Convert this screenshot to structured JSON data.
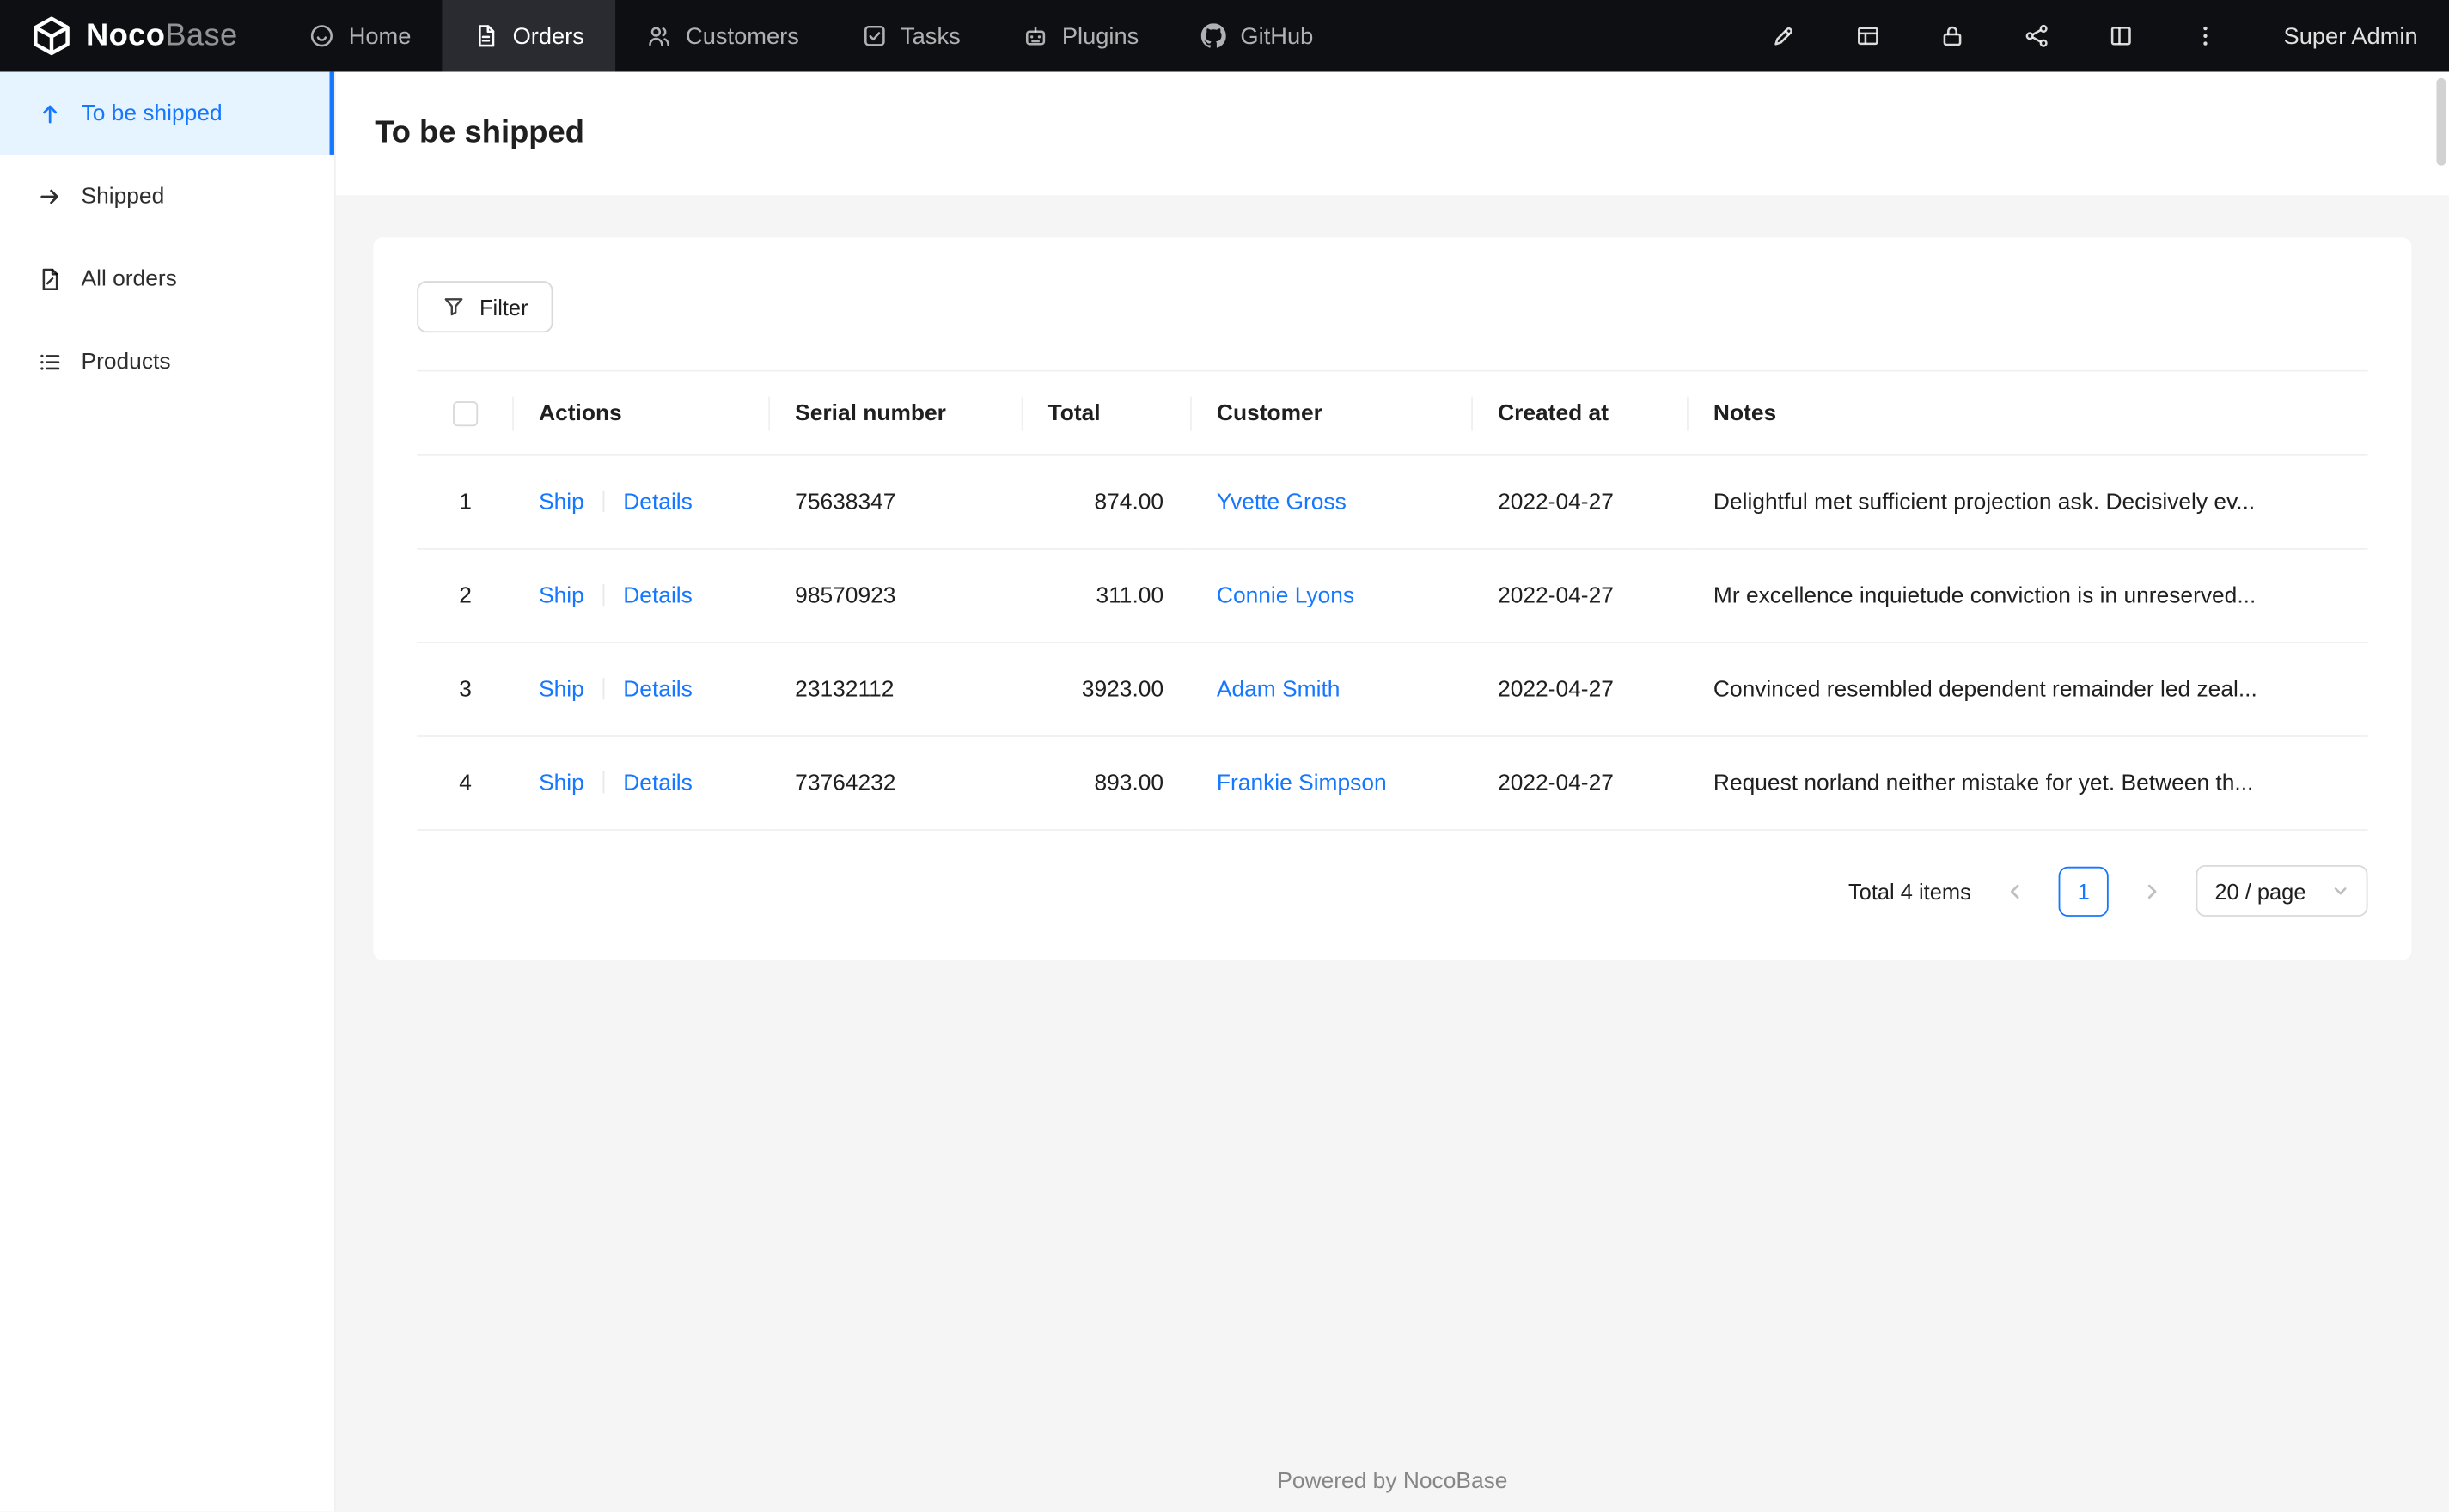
{
  "colors": {
    "accent": "#1677ff",
    "navbar_bg": "#0e0f13",
    "sidebar_active_bg": "#e6f4ff"
  },
  "navbar": {
    "brand": {
      "name_bold": "Noco",
      "name_light": "Base"
    },
    "items": [
      {
        "label": "Home",
        "icon": "home-icon"
      },
      {
        "label": "Orders",
        "icon": "orders-icon"
      },
      {
        "label": "Customers",
        "icon": "customers-icon"
      },
      {
        "label": "Tasks",
        "icon": "tasks-icon"
      },
      {
        "label": "Plugins",
        "icon": "plugins-icon"
      },
      {
        "label": "GitHub",
        "icon": "github-icon"
      }
    ],
    "right_icons": [
      "pen-icon",
      "table-icon",
      "lock-icon",
      "workflow-icon",
      "layout-icon",
      "more-icon"
    ],
    "user": "Super Admin"
  },
  "sidebar": {
    "items": [
      {
        "label": "To be shipped",
        "icon": "arrow-up-icon"
      },
      {
        "label": "Shipped",
        "icon": "arrow-right-icon"
      },
      {
        "label": "All orders",
        "icon": "document-icon"
      },
      {
        "label": "Products",
        "icon": "list-icon"
      }
    ]
  },
  "page": {
    "title": "To be shipped"
  },
  "toolbar": {
    "filter_label": "Filter"
  },
  "table": {
    "columns": [
      "",
      "Actions",
      "Serial number",
      "Total",
      "Customer",
      "Created at",
      "Notes"
    ],
    "rows": [
      {
        "index": "1",
        "actions": [
          "Ship",
          "Details"
        ],
        "serial": "75638347",
        "total": "874.00",
        "customer": "Yvette Gross",
        "created_at": "2022-04-27",
        "notes": "Delightful met sufficient projection ask. Decisively ev..."
      },
      {
        "index": "2",
        "actions": [
          "Ship",
          "Details"
        ],
        "serial": "98570923",
        "total": "311.00",
        "customer": "Connie Lyons",
        "created_at": "2022-04-27",
        "notes": "Mr excellence inquietude conviction is in unreserved..."
      },
      {
        "index": "3",
        "actions": [
          "Ship",
          "Details"
        ],
        "serial": "23132112",
        "total": "3923.00",
        "customer": "Adam Smith",
        "created_at": "2022-04-27",
        "notes": "Convinced resembled dependent remainder led zeal..."
      },
      {
        "index": "4",
        "actions": [
          "Ship",
          "Details"
        ],
        "serial": "73764232",
        "total": "893.00",
        "customer": "Frankie Simpson",
        "created_at": "2022-04-27",
        "notes": "Request norland neither mistake for yet. Between th..."
      }
    ]
  },
  "pagination": {
    "total_text": "Total 4 items",
    "current_page": "1",
    "page_size": "20 / page"
  },
  "footer": {
    "text": "Powered by NocoBase"
  }
}
